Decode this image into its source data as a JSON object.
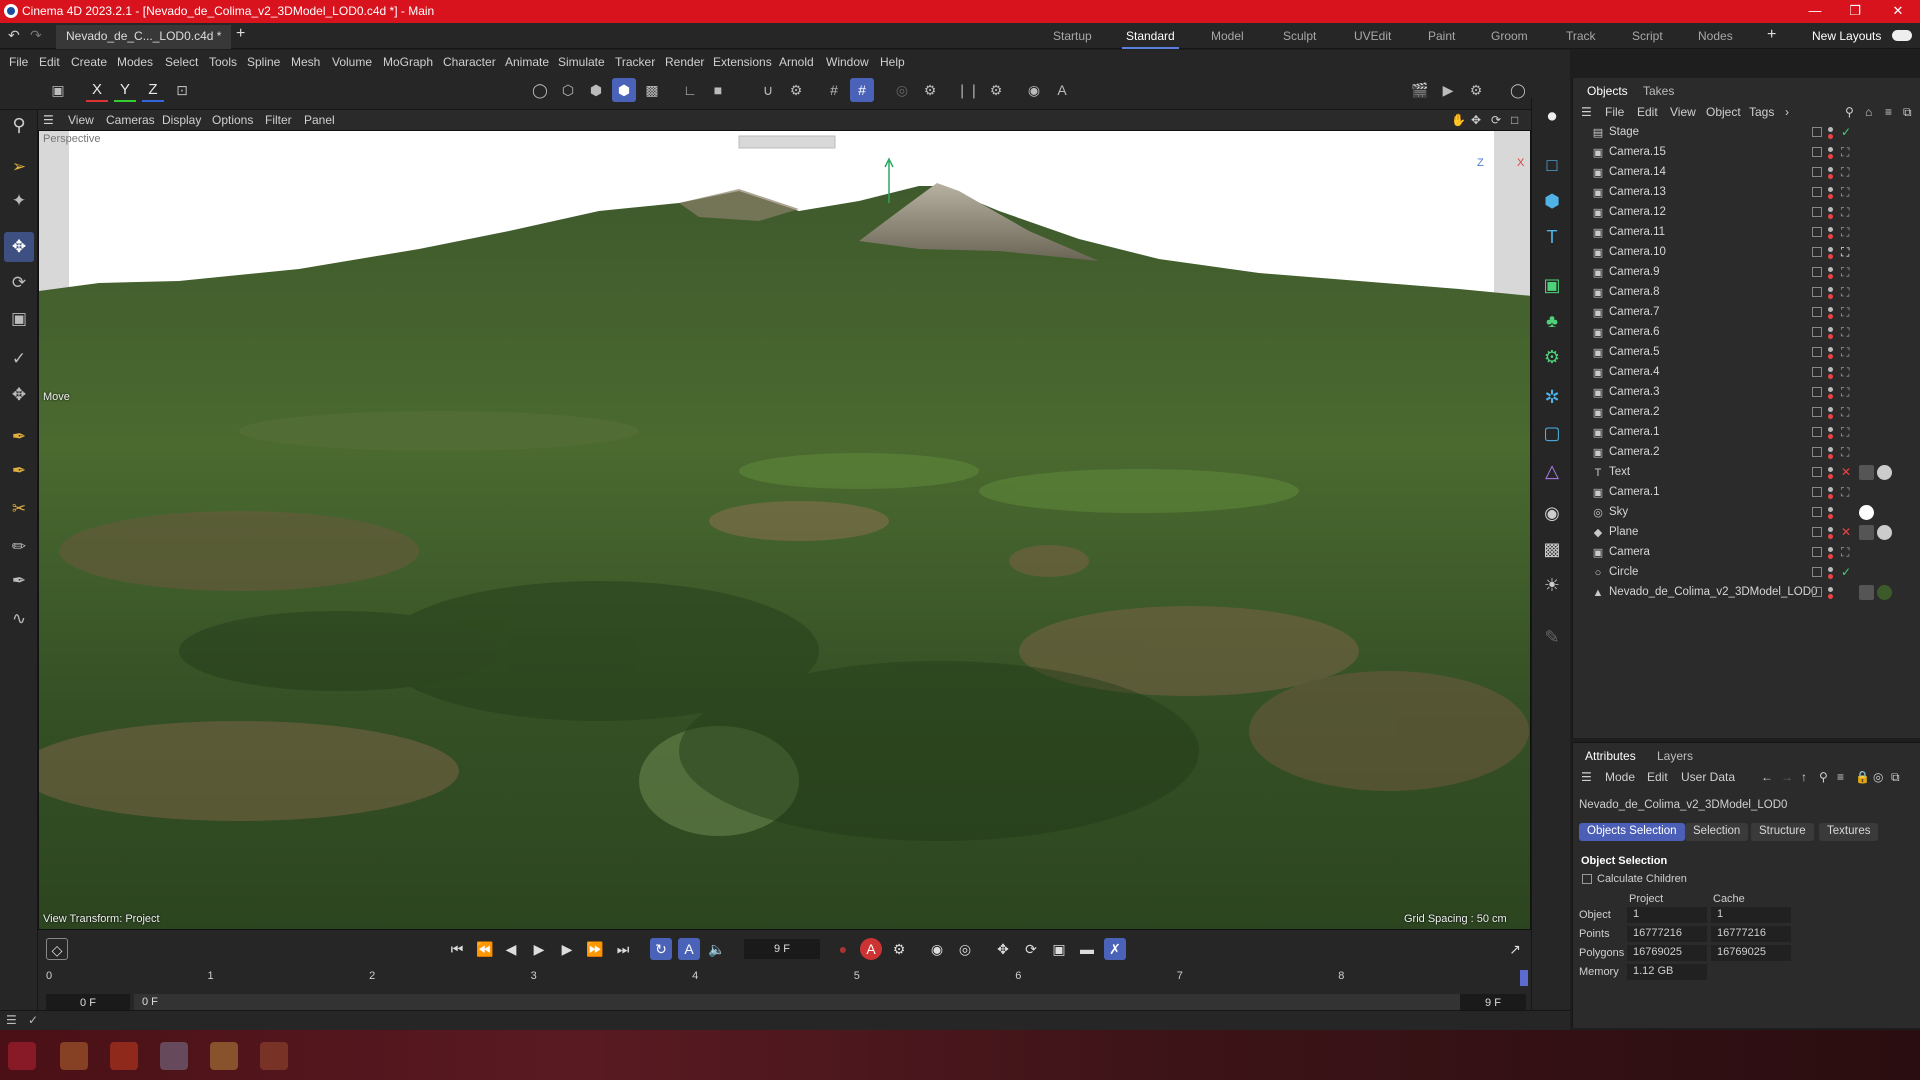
{
  "window": {
    "title": "Cinema 4D 2023.2.1 - [Nevado_de_Colima_v2_3DModel_LOD0.c4d *] - Main",
    "doc_tab": "Nevado_de_C..._LOD0.c4d *",
    "new_layouts": "New Layouts"
  },
  "layouts": [
    "Startup",
    "Standard",
    "Model",
    "Sculpt",
    "UVEdit",
    "Paint",
    "Groom",
    "Track",
    "Script",
    "Nodes"
  ],
  "active_layout": "Standard",
  "menu": [
    "File",
    "Edit",
    "Create",
    "Modes",
    "Select",
    "Tools",
    "Spline",
    "Mesh",
    "Volume",
    "MoGraph",
    "Character",
    "Animate",
    "Simulate",
    "Tracker",
    "Render",
    "Extensions",
    "Arnold",
    "Window",
    "Help"
  ],
  "toolbar": {
    "axis_x": "X",
    "axis_y": "Y",
    "axis_z": "Z"
  },
  "viewport": {
    "menu": [
      "View",
      "Cameras",
      "Display",
      "Options",
      "Filter",
      "Panel"
    ],
    "camera_label": "Perspective",
    "tool_label": "Move",
    "transform_label": "View Transform: Project",
    "grid_label": "Grid Spacing : 50 cm",
    "axis_z": "Z",
    "axis_x": "X"
  },
  "objects_panel": {
    "tabs": [
      "Objects",
      "Takes"
    ],
    "menu": [
      "File",
      "Edit",
      "View",
      "Object",
      "Tags"
    ],
    "items": [
      {
        "name": "Stage",
        "icon": "S",
        "status": "check"
      },
      {
        "name": "Camera.15",
        "icon": "C",
        "status": "target"
      },
      {
        "name": "Camera.14",
        "icon": "C",
        "status": "target"
      },
      {
        "name": "Camera.13",
        "icon": "C",
        "status": "target"
      },
      {
        "name": "Camera.12",
        "icon": "C",
        "status": "target"
      },
      {
        "name": "Camera.11",
        "icon": "C",
        "status": "target"
      },
      {
        "name": "Camera.10",
        "icon": "C",
        "status": "target-active"
      },
      {
        "name": "Camera.9",
        "icon": "C",
        "status": "target"
      },
      {
        "name": "Camera.8",
        "icon": "C",
        "status": "target"
      },
      {
        "name": "Camera.7",
        "icon": "C",
        "status": "target"
      },
      {
        "name": "Camera.6",
        "icon": "C",
        "status": "target"
      },
      {
        "name": "Camera.5",
        "icon": "C",
        "status": "target"
      },
      {
        "name": "Camera.4",
        "icon": "C",
        "status": "target"
      },
      {
        "name": "Camera.3",
        "icon": "C",
        "status": "target"
      },
      {
        "name": "Camera.2",
        "icon": "C",
        "status": "target"
      },
      {
        "name": "Camera.1",
        "icon": "C",
        "status": "target"
      },
      {
        "name": "Camera.2",
        "icon": "C",
        "status": "target"
      },
      {
        "name": "Text",
        "icon": "T",
        "status": "cross"
      },
      {
        "name": "Camera.1",
        "icon": "C",
        "status": "target"
      },
      {
        "name": "Sky",
        "icon": "K",
        "status": "none"
      },
      {
        "name": "Plane",
        "icon": "P",
        "status": "cross"
      },
      {
        "name": "Camera",
        "icon": "C",
        "status": "target"
      },
      {
        "name": "Circle",
        "icon": "O",
        "status": "check"
      },
      {
        "name": "Nevado_de_Colima_v2_3DModel_LOD0",
        "icon": "N",
        "status": "none"
      }
    ]
  },
  "attributes_panel": {
    "tabs": [
      "Attributes",
      "Layers"
    ],
    "menu": [
      "Mode",
      "Edit",
      "User Data"
    ],
    "object_name": "Nevado_de_Colima_v2_3DModel_LOD0",
    "subtabs": [
      "Objects Selection",
      "Selection",
      "Structure",
      "Textures"
    ],
    "section_title": "Object Selection",
    "calculate_children": "Calculate Children",
    "col_project": "Project",
    "col_cache": "Cache",
    "rows": [
      {
        "label": "Object",
        "project": "1",
        "cache": "1"
      },
      {
        "label": "Points",
        "project": "16777216",
        "cache": "16777216"
      },
      {
        "label": "Polygons",
        "project": "16769025",
        "cache": "16769025"
      },
      {
        "label": "Memory",
        "project": "1.12 GB",
        "cache": ""
      }
    ]
  },
  "timeline": {
    "current_frame": "9 F",
    "start_field": "0 F",
    "range_start": "0 F",
    "range_end": "9 F",
    "end_field": "9 F",
    "ticks": [
      "0",
      "1",
      "2",
      "3",
      "4",
      "5",
      "6",
      "7",
      "8"
    ]
  },
  "colors": {
    "title_red": "#d9131e",
    "accent_blue": "#4a63b8"
  }
}
